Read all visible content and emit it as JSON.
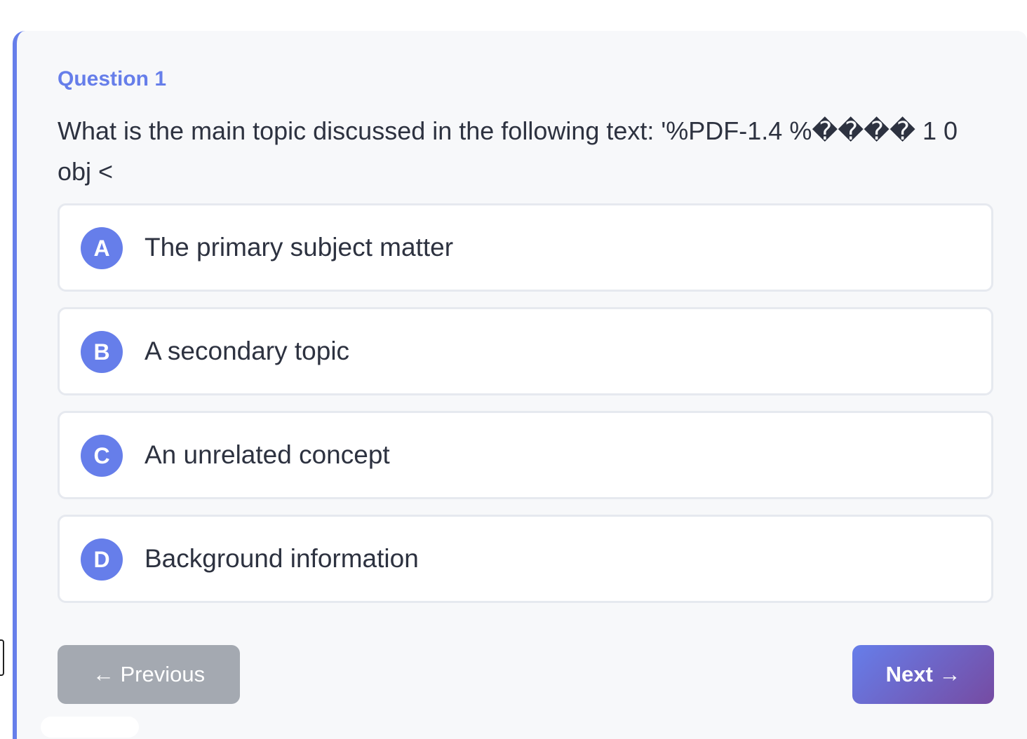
{
  "question": {
    "label": "Question 1",
    "text": "What is the main topic discussed in the following text: '%PDF-1.4 %���� 1 0 obj <"
  },
  "options": [
    {
      "letter": "A",
      "text": "The primary subject matter"
    },
    {
      "letter": "B",
      "text": "A secondary topic"
    },
    {
      "letter": "C",
      "text": "An unrelated concept"
    },
    {
      "letter": "D",
      "text": "Background information"
    }
  ],
  "navigation": {
    "previous_label": "← Previous",
    "next_label": "Next →"
  },
  "colors": {
    "accent": "#667eea",
    "accent_end": "#764ba2",
    "prev_button": "#a4a9b1"
  }
}
